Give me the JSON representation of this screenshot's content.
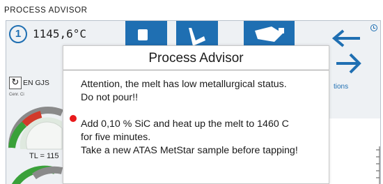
{
  "app": {
    "title": "PROCESS ADVISOR"
  },
  "status": {
    "step_number": "1",
    "temperature": "1145,6°C"
  },
  "toolbar": {
    "lang_label": "EN GJS",
    "small_label": "Cenr. Ci",
    "right_label": "tions",
    "refresh_icon": "↻"
  },
  "gauge": {
    "tl_label": "TL = 115"
  },
  "dialog": {
    "title": "Process Advisor",
    "line1": "Attention, the melt has low metallurgical status.",
    "line2": "Do not pour!!",
    "line3": "Add 0,10  % SiC and heat up the melt to 1460 C",
    "line4": "for five minutes.",
    "line5": "Take a new ATAS MetStar sample before tapping!"
  },
  "colors": {
    "accent": "#1f6fb2",
    "alert_dot": "#e8191b",
    "frame_bg": "#eef1f4"
  },
  "icons": [
    "step-circle-icon",
    "document-icon",
    "pour-icon",
    "ladle-icon",
    "arrow-left-icon",
    "arrow-right-icon",
    "clock-icon",
    "refresh-icon"
  ]
}
